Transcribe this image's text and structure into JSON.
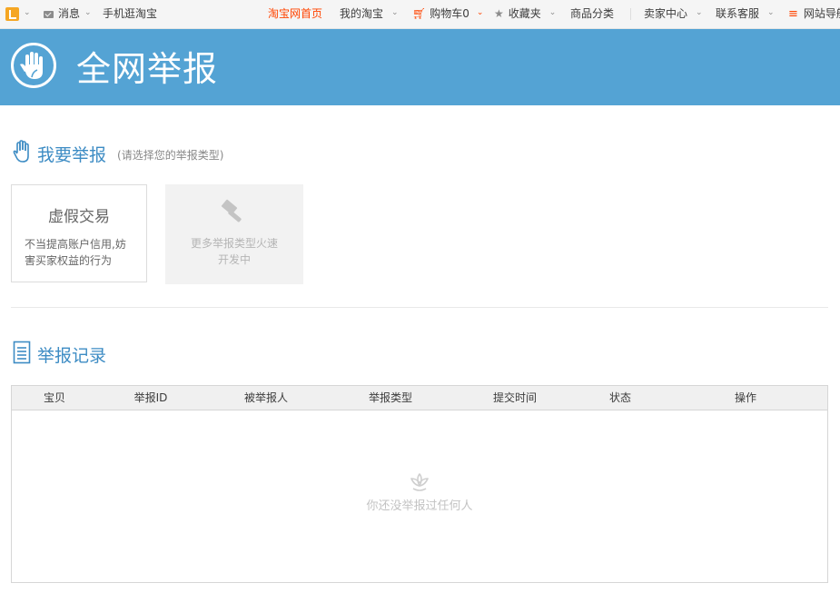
{
  "site_nav": {
    "messages": "消息",
    "mobile_taobao": "手机逛淘宝",
    "home": "淘宝网首页",
    "my_taobao": "我的淘宝",
    "cart": "购物车0",
    "favorites": "收藏夹",
    "categories": "商品分类",
    "seller_center": "卖家中心",
    "customer_service": "联系客服",
    "site_nav": "网站导航"
  },
  "banner": {
    "title": "全网举报"
  },
  "report_section": {
    "title": "我要举报",
    "subtitle": "(请选择您的举报类型)",
    "cards": [
      {
        "title": "虚假交易",
        "description": "不当提高账户信用,妨害买家权益的行为"
      },
      {
        "title": "",
        "description": "更多举报类型火速开发中"
      }
    ]
  },
  "records_section": {
    "title": "举报记录",
    "columns": [
      "宝贝",
      "举报ID",
      "被举报人",
      "举报类型",
      "提交时间",
      "状态",
      "操作"
    ],
    "rows": [],
    "empty_text": "你还没举报过任何人"
  },
  "colors": {
    "accent": "#54a3d4",
    "brand_orange": "#ff4400",
    "heading_blue": "#3d8cc4"
  },
  "icons": [
    "taobao-logo-icon",
    "mail-icon",
    "cart-icon",
    "star-icon",
    "menu-icon",
    "raised-hand-icon",
    "hand-icon",
    "hammer-icon",
    "document-list-icon",
    "lotus-icon"
  ]
}
